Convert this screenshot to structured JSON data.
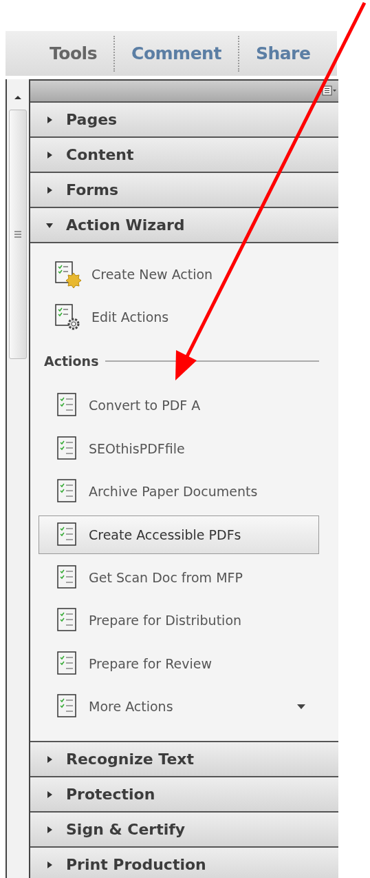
{
  "tabs": [
    {
      "label": "Tools",
      "selected": true
    },
    {
      "label": "Comment",
      "selected": false
    },
    {
      "label": "Share",
      "selected": false
    }
  ],
  "panels_top": [
    {
      "label": "Pages",
      "expanded": false
    },
    {
      "label": "Content",
      "expanded": false
    },
    {
      "label": "Forms",
      "expanded": false
    },
    {
      "label": "Action Wizard",
      "expanded": true
    }
  ],
  "action_wizard": {
    "tasks": [
      {
        "label": "Create New Action",
        "kind": "create"
      },
      {
        "label": "Edit Actions",
        "kind": "edit"
      }
    ],
    "actions_heading": "Actions",
    "actions": [
      {
        "label": "Convert to PDF A",
        "selected": false,
        "kind": "action"
      },
      {
        "label": "SEOthisPDFfile",
        "selected": false,
        "kind": "action"
      },
      {
        "label": "Archive Paper Documents",
        "selected": false,
        "kind": "action"
      },
      {
        "label": "Create Accessible PDFs",
        "selected": true,
        "kind": "action"
      },
      {
        "label": "Get Scan Doc from MFP",
        "selected": false,
        "kind": "action"
      },
      {
        "label": "Prepare for Distribution",
        "selected": false,
        "kind": "action"
      },
      {
        "label": "Prepare for Review",
        "selected": false,
        "kind": "action"
      },
      {
        "label": "More Actions",
        "selected": false,
        "kind": "more"
      }
    ]
  },
  "panels_bottom": [
    {
      "label": "Recognize Text",
      "expanded": false
    },
    {
      "label": "Protection",
      "expanded": false
    },
    {
      "label": "Sign & Certify",
      "expanded": false
    },
    {
      "label": "Print Production",
      "expanded": false
    }
  ]
}
